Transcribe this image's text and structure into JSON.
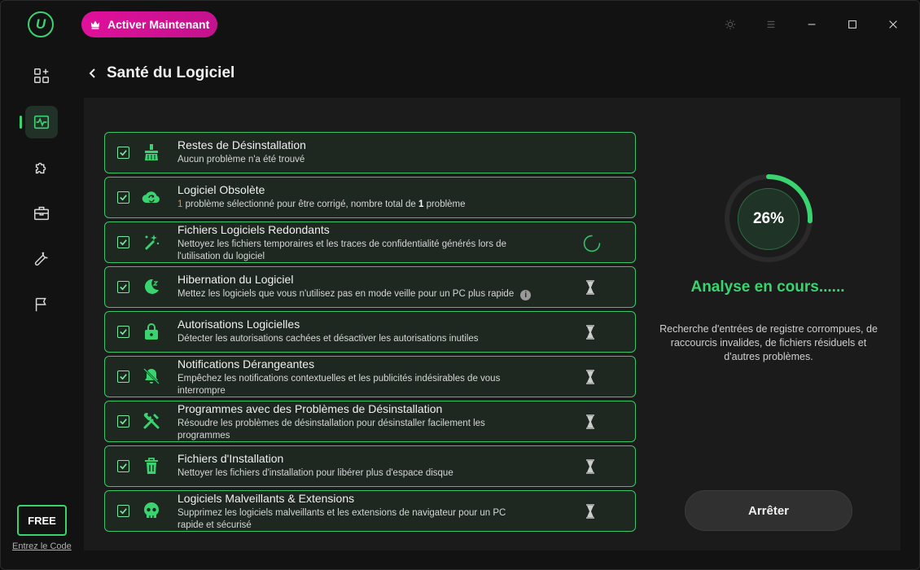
{
  "app": {
    "logo_text": "U",
    "activate_label": "Activer Maintenant",
    "accent_color": "#39d46f",
    "activate_color": "#e0109a"
  },
  "window_controls": [
    "sun-icon",
    "menu-icon",
    "minimize-icon",
    "maximize-icon",
    "close-icon"
  ],
  "sidebar": {
    "items": [
      {
        "icon": "apps-add-icon",
        "active": false
      },
      {
        "icon": "health-pulse-icon",
        "active": true
      },
      {
        "icon": "puzzle-icon",
        "active": false
      },
      {
        "icon": "toolbox-icon",
        "active": false
      },
      {
        "icon": "wrench-icon",
        "active": false
      },
      {
        "icon": "flag-icon",
        "active": false
      }
    ],
    "free_label": "FREE",
    "code_link": "Entrez le Code"
  },
  "header": {
    "title": "Santé du Logiciel"
  },
  "items": [
    {
      "title": "Restes de Désinstallation",
      "desc": "Aucun problème n'a été trouvé",
      "icon": "broom-icon",
      "checked": true,
      "status": "done"
    },
    {
      "title": "Logiciel Obsolète",
      "desc_num1": "1",
      "desc_part1": " problème sélectionné pour être corrigé, nombre total de ",
      "desc_num2": "1",
      "desc_part2": " problème",
      "icon": "cloud-refresh-icon",
      "checked": true,
      "status": "done"
    },
    {
      "title": "Fichiers Logiciels Redondants",
      "desc": "Nettoyez les fichiers temporaires et les traces de confidentialité générés lors de l'utilisation du logiciel",
      "icon": "magic-wand-icon",
      "checked": true,
      "status": "scanning"
    },
    {
      "title": "Hibernation du Logiciel",
      "desc": "Mettez les logiciels que vous n'utilisez pas en mode veille pour un PC plus rapide",
      "icon": "moon-sleep-icon",
      "checked": true,
      "status": "pending"
    },
    {
      "title": "Autorisations Logicielles",
      "desc": "Détecter les autorisations cachées et désactiver les autorisations inutiles",
      "icon": "lock-icon",
      "checked": true,
      "status": "pending"
    },
    {
      "title": "Notifications Dérangeantes",
      "desc": "Empêchez les notifications contextuelles et les publicités indésirables de vous interrompre",
      "icon": "bell-off-icon",
      "checked": true,
      "status": "pending"
    },
    {
      "title": "Programmes avec des Problèmes de Désinstallation",
      "desc": "Résoudre les problèmes de désinstallation pour désinstaller facilement les programmes",
      "icon": "tools-icon",
      "checked": true,
      "status": "pending"
    },
    {
      "title": "Fichiers d'Installation",
      "desc": "Nettoyer les fichiers d'installation pour libérer plus d'espace disque",
      "icon": "trash-icon",
      "checked": true,
      "status": "pending"
    },
    {
      "title": "Logiciels Malveillants & Extensions",
      "desc": "Supprimez les logiciels malveillants et les extensions de navigateur pour un PC rapide et sécurisé",
      "icon": "skull-icon",
      "checked": true,
      "status": "pending"
    }
  ],
  "progress": {
    "percent_label": "26%",
    "fraction": 0.26,
    "status_title": "Analyse en cours......",
    "status_desc": "Recherche d'entrées de registre corrompues, de raccourcis invalides, de fichiers résiduels et d'autres problèmes.",
    "stop_label": "Arrêter"
  }
}
